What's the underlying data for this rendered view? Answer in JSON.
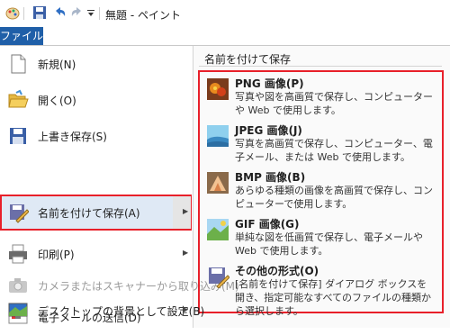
{
  "window": {
    "title": "無題 - ペイント",
    "file_tab": "ファイル"
  },
  "left_menu": {
    "items": [
      {
        "label": "新規(N)",
        "icon": "new-file-icon",
        "enabled": true,
        "submenu": false
      },
      {
        "label": "開く(O)",
        "icon": "open-folder-icon",
        "enabled": true,
        "submenu": false
      },
      {
        "label": "上書き保存(S)",
        "icon": "save-icon",
        "enabled": true,
        "submenu": false
      },
      {
        "label": "名前を付けて保存(A)",
        "icon": "save-as-icon",
        "enabled": true,
        "submenu": true,
        "highlighted": true
      },
      {
        "label": "印刷(P)",
        "icon": "printer-icon",
        "enabled": true,
        "submenu": true
      },
      {
        "label": "カメラまたはスキャナーから取り込み(M)",
        "icon": "camera-icon",
        "enabled": false,
        "submenu": false
      },
      {
        "label": "電子メールの送信(D)",
        "icon": "email-icon",
        "enabled": true,
        "submenu": false
      },
      {
        "label": "デスクトップの背景として設定(B)",
        "icon": "desktop-background-icon",
        "enabled": true,
        "submenu": true
      }
    ]
  },
  "right_panel": {
    "title": "名前を付けて保存",
    "items": [
      {
        "title": "PNG 画像(P)",
        "desc": "写真や図を高画質で保存し、コンピューターや Web で使用します。",
        "icon": "png-image-icon"
      },
      {
        "title": "JPEG 画像(J)",
        "desc": "写真を高画質で保存し、コンピューター、電子メール、または Web で使用します。",
        "icon": "jpeg-image-icon"
      },
      {
        "title": "BMP 画像(B)",
        "desc": "あらゆる種類の画像を高画質で保存し、コンピューターで使用します。",
        "icon": "bmp-image-icon"
      },
      {
        "title": "GIF 画像(G)",
        "desc": "単純な図を低画質で保存し、電子メールや Web で使用します。",
        "icon": "gif-image-icon"
      },
      {
        "title": "その他の形式(O)",
        "desc": "[名前を付けて保存] ダイアログ ボックスを開き、指定可能なすべてのファイルの種類から選択します。",
        "icon": "other-formats-icon"
      }
    ]
  },
  "colors": {
    "file_tab": "#1f5fa8",
    "highlight_border": "#e8202a",
    "highlight_fill": "#dfe9f5"
  }
}
